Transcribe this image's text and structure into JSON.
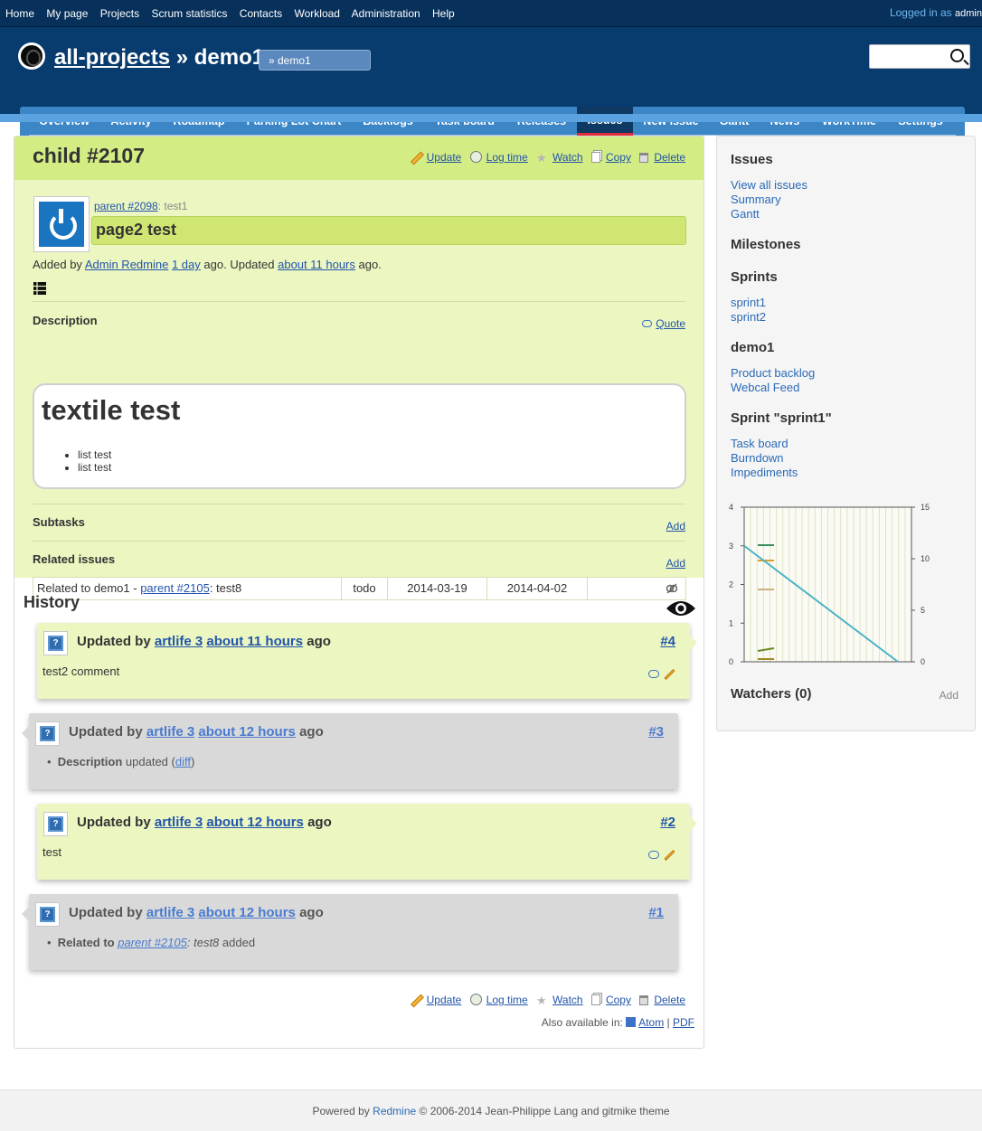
{
  "topmenu": {
    "items": [
      "Home",
      "My page",
      "Projects",
      "Scrum statistics",
      "Contacts",
      "Workload",
      "Administration",
      "Help"
    ],
    "logged_in_label": "Logged in as",
    "user": "admin"
  },
  "header": {
    "parent_project": "all-projects",
    "separator": "»",
    "project": "demo1",
    "jump": "» demo1"
  },
  "mainmenu": {
    "tabs": [
      "Overview",
      "Activity",
      "Roadmap",
      "Parking Lot Chart",
      "Backlogs",
      "Task board",
      "Releases",
      "Issues",
      "New issue",
      "Gantt",
      "News",
      "WorkTime",
      "Settings"
    ],
    "selected": "Issues"
  },
  "issue": {
    "title": "child #2107",
    "actions": {
      "update": "Update",
      "log_time": "Log time",
      "watch": "Watch",
      "copy": "Copy",
      "delete": "Delete"
    },
    "parent_link": "parent #2098",
    "parent_subject": ": test1",
    "subject": "page2 test",
    "added_by_prefix": "Added by",
    "author": "Admin Redmine",
    "created": "1 day",
    "ago_updated": "ago. Updated",
    "updated": "about 11 hours",
    "ago_end": "ago.",
    "description_label": "Description",
    "quote": "Quote",
    "description_heading": "textile test",
    "description_items": [
      "list test",
      "list test"
    ],
    "subtasks_label": "Subtasks",
    "related_label": "Related issues",
    "add": "Add",
    "relation": {
      "prefix": "Related to demo1 -",
      "link": "parent #2105",
      "subject": ": test8",
      "status": "todo",
      "start": "2014-03-19",
      "due": "2014-04-02"
    }
  },
  "history": {
    "title": "History",
    "journals": [
      {
        "by": "Updated by",
        "user": "artlife 3",
        "time": "about 11 hours",
        "ago": "ago",
        "num": "#4",
        "note": "test2 comment"
      },
      {
        "by": "Updated by",
        "user": "artlife 3",
        "time": "about 12 hours",
        "ago": "ago",
        "num": "#3",
        "detail_label": "Description",
        "detail_text": "updated",
        "diff": "diff"
      },
      {
        "by": "Updated by",
        "user": "artlife 3",
        "time": "about 12 hours",
        "ago": "ago",
        "num": "#2",
        "note": "test"
      },
      {
        "by": "Updated by",
        "user": "artlife 3",
        "time": "about 12 hours",
        "ago": "ago",
        "num": "#1",
        "detail_label": "Related to",
        "detail_link": "parent #2105",
        "detail_subject": ": test8",
        "detail_text": "added"
      }
    ]
  },
  "also_available": {
    "label": "Also available in:",
    "atom": "Atom",
    "pdf": "PDF"
  },
  "sidebar": {
    "issues_title": "Issues",
    "issues_links": [
      "View all issues",
      "Summary",
      "Gantt"
    ],
    "milestones_title": "Milestones",
    "sprints_title": "Sprints",
    "sprint_links": [
      "sprint1",
      "sprint2"
    ],
    "project_title": "demo1",
    "project_links": [
      "Product backlog",
      "Webcal Feed"
    ],
    "sprint_title": "Sprint \"sprint1\"",
    "sprint_tools": [
      "Task board",
      "Burndown",
      "Impediments"
    ],
    "watchers_title": "Watchers (0)",
    "watchers_add": "Add"
  },
  "chart_data": {
    "type": "line",
    "y_left_ticks": [
      "0",
      "1",
      "2",
      "3",
      "4"
    ],
    "y_right_ticks": [
      "0",
      "5",
      "10",
      "15"
    ],
    "ylim_left": [
      0,
      4
    ],
    "ylim_right": [
      0,
      15
    ],
    "series": [
      {
        "values": [
          3,
          0
        ],
        "color": "#4bb3c6"
      }
    ],
    "grid": true,
    "colors": {
      "line": "#4bb3c6"
    }
  },
  "footer": {
    "powered": "Powered by",
    "redmine": "Redmine",
    "rest": "© 2006-2014 Jean-Philippe Lang and gitmike theme"
  }
}
